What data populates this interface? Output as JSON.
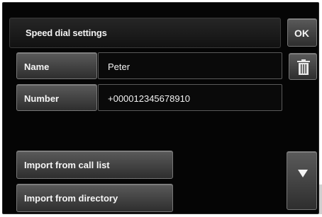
{
  "header": {
    "title": "Speed dial settings",
    "ok_label": "OK"
  },
  "fields": {
    "name": {
      "label": "Name",
      "value": "Peter"
    },
    "number": {
      "label": "Number",
      "value": "+000012345678910"
    }
  },
  "actions": {
    "import_call_list": "Import from call list",
    "import_directory": "Import from directory"
  },
  "icons": {
    "delete": "trash-icon",
    "scroll": "triangle-down-icon"
  },
  "colors": {
    "background": "#050505",
    "button": "#4a4a4a",
    "text": "#f2f2f2"
  }
}
